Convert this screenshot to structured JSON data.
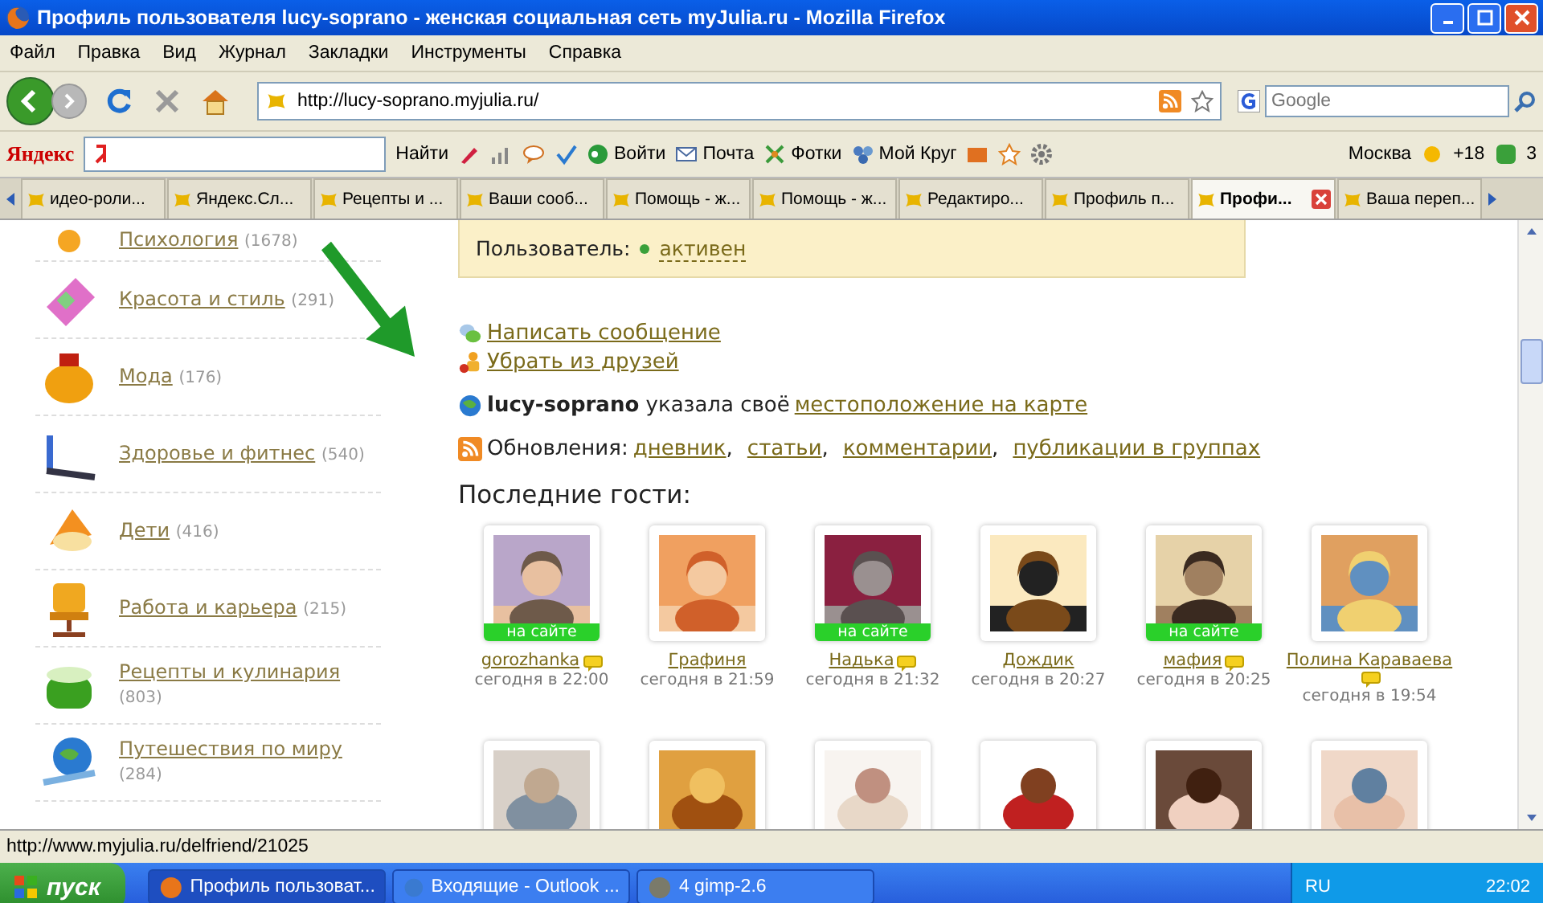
{
  "window": {
    "title": "Профиль пользователя lucy-soprano - женская социальная сеть myJulia.ru - Mozilla Firefox"
  },
  "menu": [
    "Файл",
    "Правка",
    "Вид",
    "Журнал",
    "Закладки",
    "Инструменты",
    "Справка"
  ],
  "nav": {
    "url": "http://lucy-soprano.myjulia.ru/",
    "search_placeholder": "Google"
  },
  "yandex_toolbar": {
    "logo": "Яндекс",
    "find": "Найти",
    "login": "Войти",
    "mail": "Почта",
    "photos": "Фотки",
    "circle": "Мой Круг",
    "city": "Москва",
    "temperature": "+18",
    "count": "3"
  },
  "tabs": [
    {
      "label": "идео-роли...",
      "selected": false
    },
    {
      "label": "Яндекс.Сл...",
      "selected": false
    },
    {
      "label": "Рецепты и ...",
      "selected": false
    },
    {
      "label": "Ваши сооб...",
      "selected": false
    },
    {
      "label": "Помощь - ж...",
      "selected": false
    },
    {
      "label": "Помощь - ж...",
      "selected": false
    },
    {
      "label": "Редактиро...",
      "selected": false
    },
    {
      "label": "Профиль п...",
      "selected": false
    },
    {
      "label": "Профи...",
      "selected": true
    },
    {
      "label": "Ваша переп...",
      "selected": false
    }
  ],
  "sidebar": {
    "items": [
      {
        "kind": "mind",
        "name": "Психология",
        "count": "(1678)"
      },
      {
        "kind": "makeup",
        "name": "Красота и стиль",
        "count": "(291)"
      },
      {
        "kind": "perfume",
        "name": "Мода",
        "count": "(176)"
      },
      {
        "kind": "treadmill",
        "name": "Здоровье и фитнес",
        "count": "(540)"
      },
      {
        "kind": "toy",
        "name": "Дети",
        "count": "(416)"
      },
      {
        "kind": "chair",
        "name": "Работа и карьера",
        "count": "(215)"
      },
      {
        "kind": "pot",
        "name": "Рецепты и кулинария",
        "count": "(803)"
      },
      {
        "kind": "globe",
        "name": "Путешествия по миру",
        "count": "(284)"
      }
    ]
  },
  "profile": {
    "status_label": "Пользователь:",
    "status": "активен",
    "active": true,
    "actions": [
      {
        "kind": "message",
        "label": "Написать сообщение"
      },
      {
        "kind": "unfriend",
        "label": "Убрать из друзей"
      }
    ],
    "location": {
      "user": "lucy-soprano",
      "text": "указала своё",
      "link": "местоположение на карте"
    },
    "updates": {
      "label": "Обновления:",
      "links": [
        {
          "label": "дневник",
          "separator": ","
        },
        {
          "label": "статьи",
          "separator": ","
        },
        {
          "label": "комментарии",
          "separator": ","
        },
        {
          "label": "публикации в группах"
        }
      ]
    }
  },
  "guests": {
    "title": "Последние гости:",
    "items": [
      {
        "name": "gorozhanka",
        "time": "сегодня в 22:00",
        "badge": "на сайте",
        "has_message": true
      },
      {
        "name": "Графиня",
        "time": "сегодня в 21:59",
        "has_message": false
      },
      {
        "name": "Надька",
        "time": "сегодня в 21:32",
        "badge": "на сайте",
        "has_message": true
      },
      {
        "name": "Дождик",
        "time": "сегодня в 20:27",
        "has_message": false
      },
      {
        "name": "мафия",
        "time": "сегодня в 20:25",
        "badge": "на сайте",
        "has_message": true
      },
      {
        "name": "Полина Караваева",
        "time": "сегодня в 19:54",
        "has_message": true
      }
    ]
  },
  "status_bar": "http://www.myjulia.ru/delfriend/21025",
  "taskbar": {
    "start": "пуск",
    "tasks": [
      {
        "label": "Профиль пользоват...",
        "selected": true
      },
      {
        "label": "Входящие - Outlook ...",
        "selected": false
      },
      {
        "label": "4  gimp-2.6",
        "selected": false
      }
    ],
    "language": "RU",
    "clock": "22:02"
  }
}
